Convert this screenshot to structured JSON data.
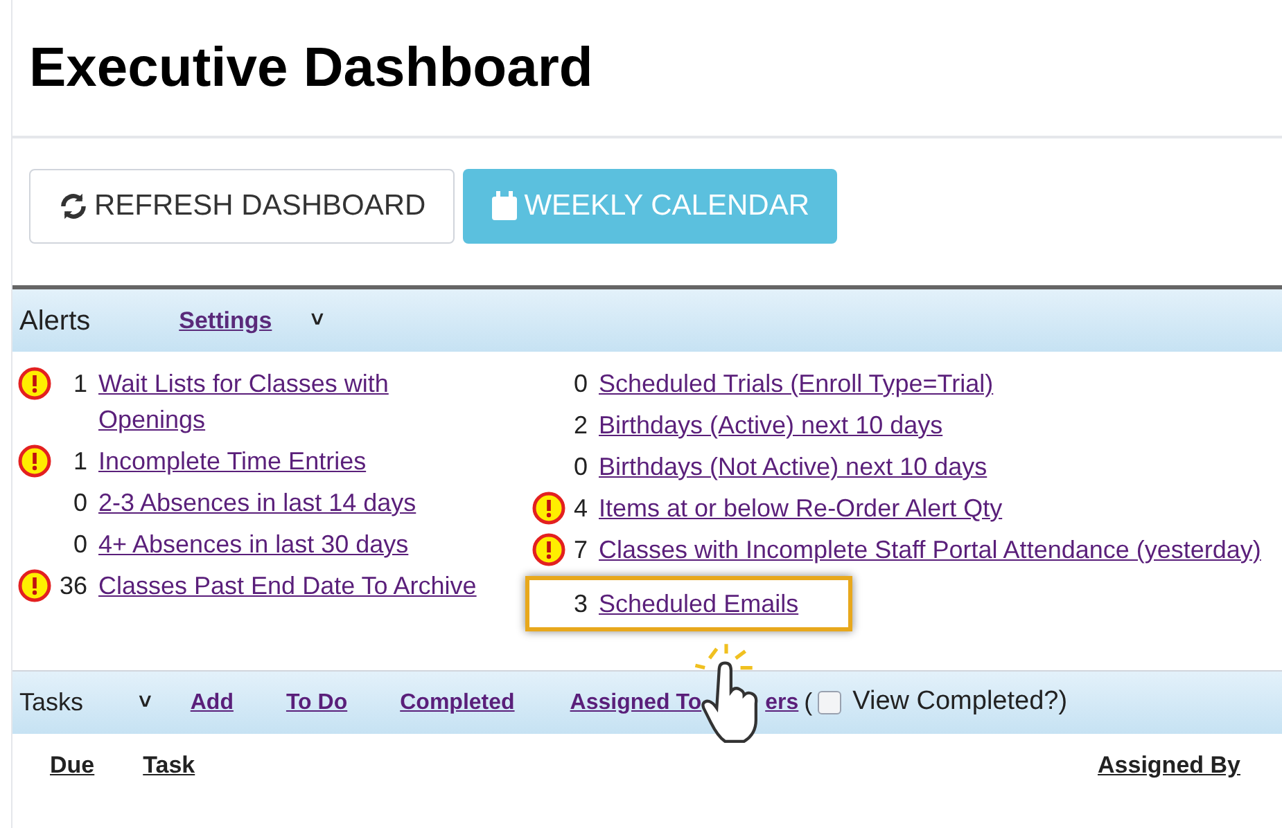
{
  "title": "Executive Dashboard",
  "buttons": [
    {
      "label": "REFRESH DASHBOARD",
      "kind": "refresh"
    },
    {
      "label": "WEEKLY CALENDAR",
      "kind": "calendar"
    }
  ],
  "alerts": {
    "heading": "Alerts",
    "settings_link": "Settings",
    "expand_glyph": "˅",
    "columns": [
      [
        {
          "count": "1",
          "label": "Wait Lists for Classes with Openings",
          "warning": true
        },
        {
          "count": "1",
          "label": "Incomplete Time Entries",
          "warning": true
        },
        {
          "count": "0",
          "label": "2-3 Absences in last 14 days",
          "warning": false
        },
        {
          "count": "0",
          "label": "4+ Absences in last 30 days",
          "warning": false
        },
        {
          "count": "36",
          "label": "Classes Past End Date To Archive",
          "warning": true
        }
      ],
      [
        {
          "count": "0",
          "label": "Scheduled Trials (Enroll Type=Trial)",
          "warning": false,
          "highlighted": false
        },
        {
          "count": "2",
          "label": "Birthdays (Active) next 10 days",
          "warning": false,
          "highlighted": false
        },
        {
          "count": "0",
          "label": "Birthdays (Not Active) next 10 days",
          "warning": false,
          "highlighted": false
        },
        {
          "count": "4",
          "label": "Items at or below Re-Order Alert Qty",
          "warning": true,
          "highlighted": false
        },
        {
          "count": "7",
          "label": "Classes with Incomplete Staff Portal Attendance (yesterday)",
          "warning": true,
          "highlighted": false
        },
        {
          "count": "3",
          "label": "Scheduled Emails",
          "warning": false,
          "highlighted": true
        }
      ]
    ]
  },
  "tasks": {
    "heading": "Tasks",
    "links": [
      "Add",
      "To Do",
      "Completed"
    ],
    "assigned_link_parts": [
      "Assigned To",
      "ers"
    ],
    "paren": "(",
    "view_completed": {
      "label": "View Completed?)",
      "checked": false
    },
    "columns": [
      "Due",
      "Task",
      "Assigned By"
    ]
  }
}
